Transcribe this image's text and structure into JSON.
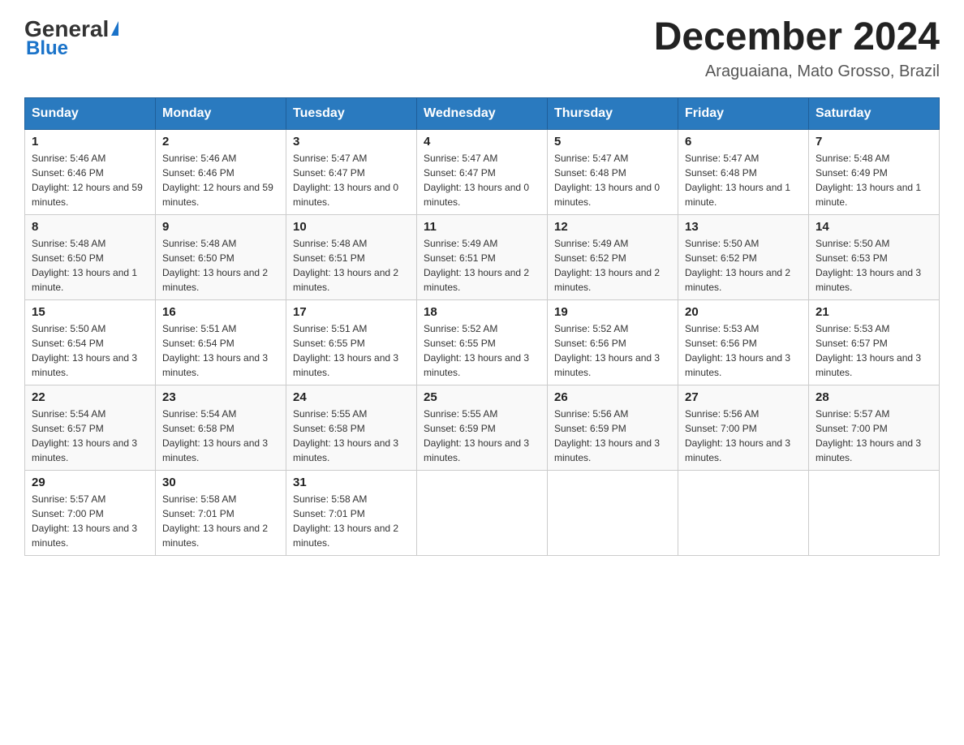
{
  "header": {
    "logo": {
      "general": "General",
      "blue": "Blue",
      "triangle": "▲"
    },
    "title": "December 2024",
    "location": "Araguaiana, Mato Grosso, Brazil"
  },
  "days_of_week": [
    "Sunday",
    "Monday",
    "Tuesday",
    "Wednesday",
    "Thursday",
    "Friday",
    "Saturday"
  ],
  "weeks": [
    [
      {
        "day": "1",
        "sunrise": "5:46 AM",
        "sunset": "6:46 PM",
        "daylight": "12 hours and 59 minutes."
      },
      {
        "day": "2",
        "sunrise": "5:46 AM",
        "sunset": "6:46 PM",
        "daylight": "12 hours and 59 minutes."
      },
      {
        "day": "3",
        "sunrise": "5:47 AM",
        "sunset": "6:47 PM",
        "daylight": "13 hours and 0 minutes."
      },
      {
        "day": "4",
        "sunrise": "5:47 AM",
        "sunset": "6:47 PM",
        "daylight": "13 hours and 0 minutes."
      },
      {
        "day": "5",
        "sunrise": "5:47 AM",
        "sunset": "6:48 PM",
        "daylight": "13 hours and 0 minutes."
      },
      {
        "day": "6",
        "sunrise": "5:47 AM",
        "sunset": "6:48 PM",
        "daylight": "13 hours and 1 minute."
      },
      {
        "day": "7",
        "sunrise": "5:48 AM",
        "sunset": "6:49 PM",
        "daylight": "13 hours and 1 minute."
      }
    ],
    [
      {
        "day": "8",
        "sunrise": "5:48 AM",
        "sunset": "6:50 PM",
        "daylight": "13 hours and 1 minute."
      },
      {
        "day": "9",
        "sunrise": "5:48 AM",
        "sunset": "6:50 PM",
        "daylight": "13 hours and 2 minutes."
      },
      {
        "day": "10",
        "sunrise": "5:48 AM",
        "sunset": "6:51 PM",
        "daylight": "13 hours and 2 minutes."
      },
      {
        "day": "11",
        "sunrise": "5:49 AM",
        "sunset": "6:51 PM",
        "daylight": "13 hours and 2 minutes."
      },
      {
        "day": "12",
        "sunrise": "5:49 AM",
        "sunset": "6:52 PM",
        "daylight": "13 hours and 2 minutes."
      },
      {
        "day": "13",
        "sunrise": "5:50 AM",
        "sunset": "6:52 PM",
        "daylight": "13 hours and 2 minutes."
      },
      {
        "day": "14",
        "sunrise": "5:50 AM",
        "sunset": "6:53 PM",
        "daylight": "13 hours and 3 minutes."
      }
    ],
    [
      {
        "day": "15",
        "sunrise": "5:50 AM",
        "sunset": "6:54 PM",
        "daylight": "13 hours and 3 minutes."
      },
      {
        "day": "16",
        "sunrise": "5:51 AM",
        "sunset": "6:54 PM",
        "daylight": "13 hours and 3 minutes."
      },
      {
        "day": "17",
        "sunrise": "5:51 AM",
        "sunset": "6:55 PM",
        "daylight": "13 hours and 3 minutes."
      },
      {
        "day": "18",
        "sunrise": "5:52 AM",
        "sunset": "6:55 PM",
        "daylight": "13 hours and 3 minutes."
      },
      {
        "day": "19",
        "sunrise": "5:52 AM",
        "sunset": "6:56 PM",
        "daylight": "13 hours and 3 minutes."
      },
      {
        "day": "20",
        "sunrise": "5:53 AM",
        "sunset": "6:56 PM",
        "daylight": "13 hours and 3 minutes."
      },
      {
        "day": "21",
        "sunrise": "5:53 AM",
        "sunset": "6:57 PM",
        "daylight": "13 hours and 3 minutes."
      }
    ],
    [
      {
        "day": "22",
        "sunrise": "5:54 AM",
        "sunset": "6:57 PM",
        "daylight": "13 hours and 3 minutes."
      },
      {
        "day": "23",
        "sunrise": "5:54 AM",
        "sunset": "6:58 PM",
        "daylight": "13 hours and 3 minutes."
      },
      {
        "day": "24",
        "sunrise": "5:55 AM",
        "sunset": "6:58 PM",
        "daylight": "13 hours and 3 minutes."
      },
      {
        "day": "25",
        "sunrise": "5:55 AM",
        "sunset": "6:59 PM",
        "daylight": "13 hours and 3 minutes."
      },
      {
        "day": "26",
        "sunrise": "5:56 AM",
        "sunset": "6:59 PM",
        "daylight": "13 hours and 3 minutes."
      },
      {
        "day": "27",
        "sunrise": "5:56 AM",
        "sunset": "7:00 PM",
        "daylight": "13 hours and 3 minutes."
      },
      {
        "day": "28",
        "sunrise": "5:57 AM",
        "sunset": "7:00 PM",
        "daylight": "13 hours and 3 minutes."
      }
    ],
    [
      {
        "day": "29",
        "sunrise": "5:57 AM",
        "sunset": "7:00 PM",
        "daylight": "13 hours and 3 minutes."
      },
      {
        "day": "30",
        "sunrise": "5:58 AM",
        "sunset": "7:01 PM",
        "daylight": "13 hours and 2 minutes."
      },
      {
        "day": "31",
        "sunrise": "5:58 AM",
        "sunset": "7:01 PM",
        "daylight": "13 hours and 2 minutes."
      },
      null,
      null,
      null,
      null
    ]
  ],
  "colors": {
    "header_bg": "#2a7abf",
    "header_text": "#ffffff",
    "border": "#aaa",
    "logo_blue": "#1a73c9"
  }
}
